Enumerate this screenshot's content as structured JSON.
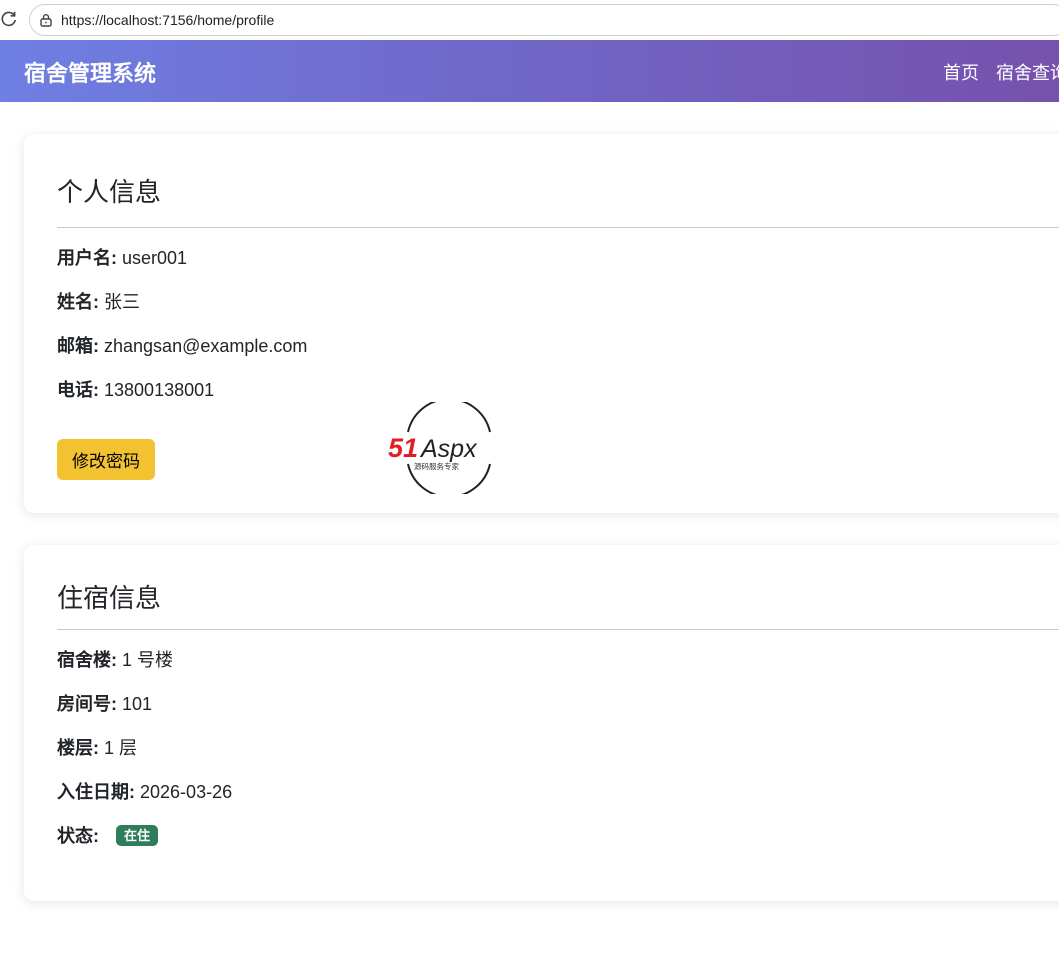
{
  "browser": {
    "url": "https://localhost:7156/home/profile",
    "reload_icon": "reload-icon",
    "lock_icon": "lock-icon"
  },
  "navbar": {
    "brand": "宿舍管理系统",
    "items": [
      {
        "label": "首页"
      },
      {
        "label": "宿舍查询"
      }
    ],
    "gradient_start": "#6f7fe3",
    "gradient_end": "#7651ad"
  },
  "profile": {
    "title": "个人信息",
    "fields": [
      {
        "label": "用户名:",
        "value": "user001"
      },
      {
        "label": "姓名:",
        "value": "张三"
      },
      {
        "label": "邮箱:",
        "value": "zhangsan@example.com"
      },
      {
        "label": "电话:",
        "value": "13800138001"
      }
    ],
    "change_password_label": "修改密码",
    "button_color": "#f3c230"
  },
  "dorm": {
    "title": "住宿信息",
    "fields": [
      {
        "label": "宿舍楼:",
        "value": "1 号楼"
      },
      {
        "label": "房间号:",
        "value": "101"
      },
      {
        "label": "楼层:",
        "value": "1 层"
      },
      {
        "label": "入住日期:",
        "value": "2026-03-26"
      }
    ],
    "status_label": "状态:",
    "status_value": "在住",
    "status_color": "#2e7d5b"
  },
  "watermark": {
    "brand_number": "51",
    "brand_text": "Aspx",
    "tagline": "源码服务专家"
  }
}
